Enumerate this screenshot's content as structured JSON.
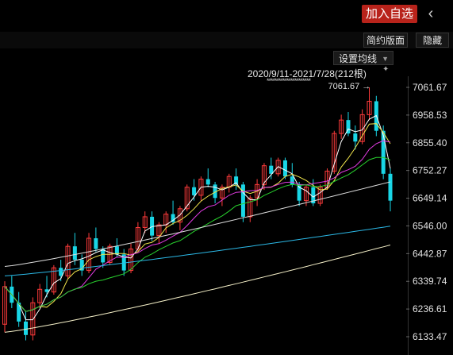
{
  "header": {
    "add_watchlist_label": "加入自选",
    "back_icon": "chevron-left-icon"
  },
  "toolbar": {
    "simple_layout_label": "简约版面",
    "hide_label": "隐藏"
  },
  "ma_settings": {
    "label": "设置均线",
    "caret_icon": "triangle-down-icon"
  },
  "range_info": {
    "text": "2020/9/11-2021/7/28(212根)",
    "pin_icon": "pin-icon",
    "stars": "**********************"
  },
  "chart_data": {
    "type": "candlestick",
    "y_ticks": [
      "7061.67",
      "6958.53",
      "6855.40",
      "6752.27",
      "6649.14",
      "6546.00",
      "6442.87",
      "6339.74",
      "6236.61",
      "6133.47"
    ],
    "ylim": [
      6133.47,
      7061.67
    ],
    "max_annotation": "7061.67",
    "max_value": 7061.67,
    "colors": {
      "up": "#ff3b3b",
      "down": "#19d6e6",
      "ma5": "#ffffff",
      "ma10": "#f2e64d",
      "ma20": "#e23be3",
      "ma30": "#28d12e",
      "ma60": "#dddddd",
      "ma120": "#2bb8e6",
      "ma250": "#f5f0c8"
    },
    "candles": [
      [
        6180,
        6340,
        6150,
        6320
      ],
      [
        6320,
        6360,
        6240,
        6260
      ],
      [
        6260,
        6300,
        6170,
        6190
      ],
      [
        6190,
        6230,
        6120,
        6140
      ],
      [
        6140,
        6280,
        6120,
        6260
      ],
      [
        6260,
        6330,
        6240,
        6310
      ],
      [
        6310,
        6360,
        6280,
        6300
      ],
      [
        6300,
        6400,
        6290,
        6390
      ],
      [
        6390,
        6420,
        6340,
        6360
      ],
      [
        6360,
        6480,
        6350,
        6470
      ],
      [
        6470,
        6520,
        6400,
        6420
      ],
      [
        6420,
        6440,
        6360,
        6380
      ],
      [
        6380,
        6520,
        6370,
        6500
      ],
      [
        6500,
        6540,
        6450,
        6460
      ],
      [
        6460,
        6470,
        6390,
        6410
      ],
      [
        6410,
        6480,
        6400,
        6470
      ],
      [
        6470,
        6500,
        6430,
        6440
      ],
      [
        6440,
        6460,
        6360,
        6380
      ],
      [
        6380,
        6480,
        6370,
        6460
      ],
      [
        6460,
        6560,
        6450,
        6540
      ],
      [
        6540,
        6600,
        6520,
        6580
      ],
      [
        6580,
        6600,
        6490,
        6510
      ],
      [
        6510,
        6560,
        6480,
        6550
      ],
      [
        6550,
        6600,
        6520,
        6590
      ],
      [
        6590,
        6640,
        6550,
        6560
      ],
      [
        6560,
        6620,
        6530,
        6610
      ],
      [
        6610,
        6700,
        6600,
        6690
      ],
      [
        6690,
        6720,
        6640,
        6660
      ],
      [
        6660,
        6730,
        6640,
        6720
      ],
      [
        6720,
        6760,
        6690,
        6700
      ],
      [
        6700,
        6710,
        6630,
        6650
      ],
      [
        6650,
        6700,
        6620,
        6690
      ],
      [
        6690,
        6740,
        6670,
        6730
      ],
      [
        6730,
        6760,
        6680,
        6700
      ],
      [
        6700,
        6710,
        6560,
        6580
      ],
      [
        6580,
        6660,
        6560,
        6650
      ],
      [
        6650,
        6720,
        6620,
        6700
      ],
      [
        6700,
        6780,
        6680,
        6770
      ],
      [
        6770,
        6800,
        6720,
        6740
      ],
      [
        6740,
        6800,
        6730,
        6790
      ],
      [
        6790,
        6800,
        6720,
        6730
      ],
      [
        6730,
        6780,
        6690,
        6700
      ],
      [
        6700,
        6710,
        6620,
        6640
      ],
      [
        6640,
        6700,
        6620,
        6690
      ],
      [
        6690,
        6720,
        6620,
        6630
      ],
      [
        6630,
        6700,
        6620,
        6690
      ],
      [
        6690,
        6760,
        6680,
        6750
      ],
      [
        6750,
        6900,
        6740,
        6890
      ],
      [
        6890,
        6960,
        6870,
        6940
      ],
      [
        6940,
        6970,
        6880,
        6890
      ],
      [
        6890,
        6920,
        6830,
        6860
      ],
      [
        6860,
        6980,
        6850,
        6960
      ],
      [
        6960,
        7061.67,
        6940,
        7010
      ],
      [
        7010,
        7030,
        6880,
        6900
      ],
      [
        6900,
        6920,
        6720,
        6740
      ],
      [
        6740,
        6760,
        6600,
        6640
      ]
    ]
  }
}
